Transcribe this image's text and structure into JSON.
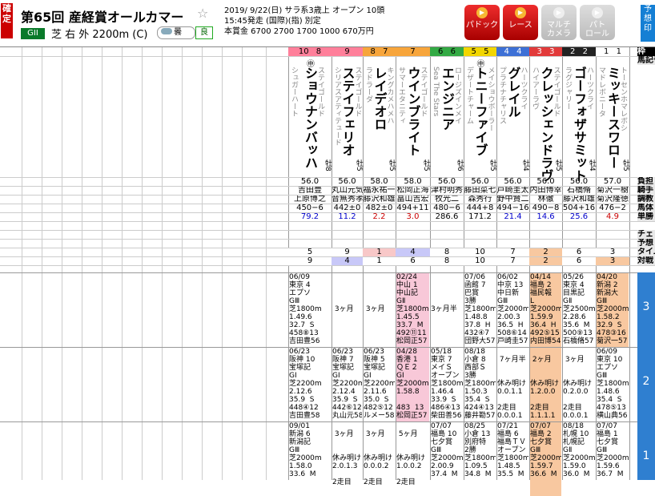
{
  "header": {
    "kakutei": "確定",
    "title": "第65回 産経賞オールカマー",
    "grade": "GII",
    "course": "芝 右 外 2200m (C)",
    "weather": "曇",
    "baba": "良",
    "info_line1": "2019/ 9/22(日) サラ系3歳上 オープン 10頭",
    "info_line2": "15:45発走 (国際)(指) 別定",
    "info_line3": "本賞金 6700 2700 1700 1000 670万円"
  },
  "toolbar": [
    {
      "name": "paddock",
      "label": "パドック",
      "enabled": true
    },
    {
      "name": "race",
      "label": "レース",
      "enabled": true
    },
    {
      "name": "multi-camera",
      "label": "マルチ\nカメラ",
      "enabled": false
    },
    {
      "name": "patrol",
      "label": "パト\nロール",
      "enabled": false
    }
  ],
  "side_button": "予想印",
  "row_labels": {
    "waku": "枠",
    "horse": "馬記号",
    "jockey_weight": "負担",
    "jockey": "騎手",
    "trainer": "調教",
    "weight": "馬体",
    "odds": "単勝",
    "check": "チェ",
    "yoso": "予想",
    "time": "タイム",
    "taisen": "対戦"
  },
  "horses": [
    {
      "num": "10",
      "waku": "8",
      "waku_color": "#ff7f9a",
      "name": "ショウナンバッハ",
      "sire": "ステイゴールド",
      "dam": "シュガーハート",
      "mark": "㊥",
      "wt": "56.0",
      "jockey": "吉田豊",
      "trainer": "上原博之",
      "bw": "450−6",
      "odds": "79.2",
      "odds_color": "#0000cc",
      "p1": "5",
      "p2": "9",
      "p1_bg": "#fff",
      "p2_bg": "#fff",
      "sex_age": "牡8"
    },
    {
      "num": "9",
      "waku": "",
      "waku_color": "#ff7f9a",
      "name": "ステイフェリオ",
      "sire": "ステイゴールド",
      "dam": "シリアスアティテュード",
      "mark": "",
      "wt": "56.0",
      "jockey": "丸山元気",
      "trainer": "音無秀孝",
      "bw": "442±0",
      "odds": "11.2",
      "odds_color": "#0000cc",
      "p1": "9",
      "p2": "4",
      "p1_bg": "#fff",
      "p2_bg": "#c8c8f8",
      "sex_age": "牡5"
    },
    {
      "num": "8",
      "waku": "7",
      "waku_color": "#f7a53b",
      "name": "レイデオロ",
      "sire": "キングカメハメハ",
      "dam": "ラドラーダ",
      "mark": "",
      "wt": "58.0",
      "jockey": "福永祐一",
      "trainer": "藤沢和雄",
      "bw": "482±0",
      "odds": "2.2",
      "odds_color": "#cc0000",
      "p1": "1",
      "p2": "1",
      "p1_bg": "#f8c8c8",
      "p2_bg": "#fff",
      "sex_age": "牡5"
    },
    {
      "num": "7",
      "waku": "",
      "waku_color": "#f7a53b",
      "name": "ウインブライト",
      "sire": "ステイゴールド",
      "dam": "サマーエタニティ",
      "mark": "",
      "wt": "58.0",
      "jockey": "松岡正海",
      "trainer": "畠山吉宏",
      "bw": "494+11",
      "odds": "3.0",
      "odds_color": "#cc0000",
      "p1": "4",
      "p2": "6",
      "p1_bg": "#c8c8f8",
      "p2_bg": "#fff",
      "sex_age": "牡5"
    },
    {
      "num": "6",
      "waku": "6",
      "waku_color": "#33aa44",
      "name": "エンジニア",
      "sire": "ロージズインメイ",
      "dam": "Sea The Stars",
      "mark": "",
      "wt": "56.0",
      "jockey": "津村明秀",
      "trainer": "牧光二",
      "bw": "480−6",
      "odds": "286.6",
      "odds_color": "#000",
      "p1": "8",
      "p2": "8",
      "p1_bg": "#fff",
      "p2_bg": "#fff",
      "sex_age": "牡6"
    },
    {
      "num": "5",
      "waku": "5",
      "waku_color": "#f2d600",
      "name": "トニーファイブ",
      "sire": "メイショウボーラー",
      "dam": "デザートチャーム",
      "mark": "㊥",
      "wt": "56.0",
      "jockey": "藤田菜七",
      "trainer": "森秀行",
      "bw": "444+8",
      "odds": "171.2",
      "odds_color": "#000",
      "p1": "10",
      "p2": "10",
      "p1_bg": "#fff",
      "p2_bg": "#fff",
      "sex_age": "牡5"
    },
    {
      "num": "4",
      "waku": "4",
      "waku_color": "#3d70d6",
      "name": "グレイル",
      "sire": "ハーツクライ",
      "dam": "プラチナチャリス",
      "mark": "",
      "wt": "56.0",
      "jockey": "戸崎圭太",
      "trainer": "野中賢二",
      "bw": "494−16",
      "odds": "21.4",
      "odds_color": "#0000cc",
      "p1": "7",
      "p2": "7",
      "p1_bg": "#fff",
      "p2_bg": "#fff",
      "sex_age": "牡4"
    },
    {
      "num": "3",
      "waku": "3",
      "waku_color": "#e23a3a",
      "name": "クレッシェンドラヴ",
      "sire": "ステイゴールド",
      "dam": "ハイアーラヴ",
      "mark": "",
      "wt": "56.0",
      "jockey": "内田博幸",
      "trainer": "林徹",
      "bw": "490−8",
      "odds": "14.6",
      "odds_color": "#0000cc",
      "p1": "2",
      "p2": "2",
      "p1_bg": "#f8c8a0",
      "p2_bg": "#f8c8a0",
      "sex_age": "牡5"
    },
    {
      "num": "2",
      "waku": "2",
      "waku_color": "#222",
      "name": "ゴーフォザサミット",
      "sire": "ハーツクライ",
      "dam": "ラグジャリー",
      "mark": "",
      "wt": "56.0",
      "jockey": "石橋脩",
      "trainer": "藤沢和雄",
      "bw": "504+16",
      "odds": "25.6",
      "odds_color": "#0000cc",
      "p1": "6",
      "p2": "6",
      "p1_bg": "#fff",
      "p2_bg": "#fff",
      "sex_age": "牡4"
    },
    {
      "num": "1",
      "waku": "1",
      "waku_color": "#fff",
      "name": "ミッキースワロー",
      "sire": "トーセンホマレボシ",
      "dam": "マドレボニータ",
      "mark": "",
      "wt": "57.0",
      "jockey": "菊沢一樹",
      "trainer": "菊沢隆徳",
      "bw": "476−2",
      "odds": "4.9",
      "odds_color": "#cc0000",
      "p1": "3",
      "p2": "3",
      "p1_bg": "#fff",
      "p2_bg": "#f8c8a0",
      "sex_age": "牡5"
    }
  ],
  "past_races": [
    {
      "label": "3",
      "rows": [
        {
          "bg": "#fff",
          "text": "06/09\n東京 4\nエプソ\nGⅢ\n芝1800m\n1.49.6\n32.7  S\n458⑧13\n吉田豊56"
        },
        {
          "bg": "#fff",
          "text": "\n\n\n\n 3ヶ月"
        },
        {
          "bg": "#fff",
          "text": "\n\n\n\n 3ヶ月"
        },
        {
          "bg": "#f8c8d8",
          "text": "02/24\n中山 1\n中山記\nGⅡ\n芝1800m\n1.45.5\n33.7  M\n492⑪11\n松岡正57"
        },
        {
          "bg": "#fff",
          "text": "\n\n\n\n3ヶ月半"
        },
        {
          "bg": "#fff",
          "text": "07/06\n函館 7\n巴賞\n3勝\n芝1800m\n1.48.8\n37.8  H\n432④7\n団野大57"
        },
        {
          "bg": "#fff",
          "text": "06/02\n中京 13\n中日新\nGⅢ\n芝2000m\n2.00.3\n36.5  H\n508⑥14\n戸崎圭57"
        },
        {
          "bg": "#f8c8a0",
          "text": "04/14\n福島 2\n福民報\nL\n芝2000m\n1.59.9\n36.4  H\n492⑤15\n内田博54"
        },
        {
          "bg": "#fff",
          "text": "05/26\n東京 4\n目黒記\nGⅡ\n芝2500m\n2.28.6\n35.6  M\n500⑨13\n石橋脩57"
        },
        {
          "bg": "#f8c8a0",
          "text": "04/20\n新潟 2\n新潟大\nGⅢ\n芝2000m\n1.58.2\n32.9  S\n478③16\n菊沢一57"
        }
      ]
    },
    {
      "label": "2",
      "rows": [
        {
          "bg": "#fff",
          "text": "06/23\n阪神 10\n宝塚記\nGⅠ\n芝2200m\n2.12.6\n35.9  S\n448④12\n吉田豊58"
        },
        {
          "bg": "#fff",
          "text": "06/23\n阪神 7\n宝塚記\nGⅠ\n芝2200m\n2.12.4\n35.9  S\n442⑥12\n丸山元58"
        },
        {
          "bg": "#fff",
          "text": "06/23\n阪神 5\n宝塚記\nGⅠ\n芝2200m\n2.11.6\n35.0  S\n482⑤12\nルメー58"
        },
        {
          "bg": "#f8c8d8",
          "text": "04/28\n香港 1\nＱＥ２\nGⅠ\n芝2000m\n1.58.8\n\n483  13\n松岡正57"
        },
        {
          "bg": "#fff",
          "text": "05/18\n東京 7\nメイＳ\nオープン\n芝1800m\n1.46.4\n33.9  S\n486④13\n柴田善56"
        },
        {
          "bg": "#fff",
          "text": "08/18\n小倉 8\n西部Ｓ\n3勝\n芝1800m\n1.50.3\n35.4  S\n424④13\n藤井勘57"
        },
        {
          "bg": "#fff",
          "text": "\n 7ヶ月半\n\n\n休み明け\n0.0.1.1\n\n2走目\n0.0.0.1"
        },
        {
          "bg": "#f8c8a0",
          "text": "\n 2ヶ月\n\n\n休み明け\n1.2.0.0\n\n2走目\n1.1.1.1"
        },
        {
          "bg": "#fff",
          "text": "\n 3ヶ月\n\n\n休み明け\n0.2.0.0\n\n2走目\n0.0.0.1"
        },
        {
          "bg": "#fff",
          "text": "06/09\n東京 10\nエプソ\nGⅢ\n芝1800m\n1.48.6\n35.4  S\n478⑤13\n横山典56"
        }
      ]
    },
    {
      "label": "1",
      "rows": [
        {
          "bg": "#fff",
          "text": "09/01\n新潟 6\n新潟記\nGⅢ\n芝2000m\n1.58.0\n33.6  M"
        },
        {
          "bg": "#fff",
          "text": "\n 3ヶ月\n\n\n休み明け\n2.0.1.3\n\n2走目"
        },
        {
          "bg": "#fff",
          "text": "\n 3ヶ月\n\n\n休み明け\n0.0.0.2\n\n2走目"
        },
        {
          "bg": "#fff",
          "text": "\n 5ヶ月\n\n\n休み明け\n1.0.0.2\n\n2走目"
        },
        {
          "bg": "#fff",
          "text": "07/07\n福島 10\n七夕賞\nGⅢ\n芝2000m\n2.00.9\n37.4  M"
        },
        {
          "bg": "#fff",
          "text": "08/25\n小倉 13\n別府特\n2勝\n芝1800m\n1.09.5\n34.8  M"
        },
        {
          "bg": "#fff",
          "text": "07/21\n福島 6\n福島ＴＶ\nオープン\n芝1800m\n1.48.5\n35.5  M"
        },
        {
          "bg": "#f8c8a0",
          "text": "07/07\n福島 2\n七夕賞\nGⅢ\n芝2000m\n1.59.7\n36.6  M"
        },
        {
          "bg": "#fff",
          "text": "08/18\n札幌 10\n札幌記\nGⅡ\n芝2000m\n1.59.0\n36.0  M"
        },
        {
          "bg": "#fff",
          "text": "07/07\n福島 1\n七夕賞\nGⅢ\n芝2000m\n1.59.6\n36.7  M"
        }
      ]
    }
  ]
}
